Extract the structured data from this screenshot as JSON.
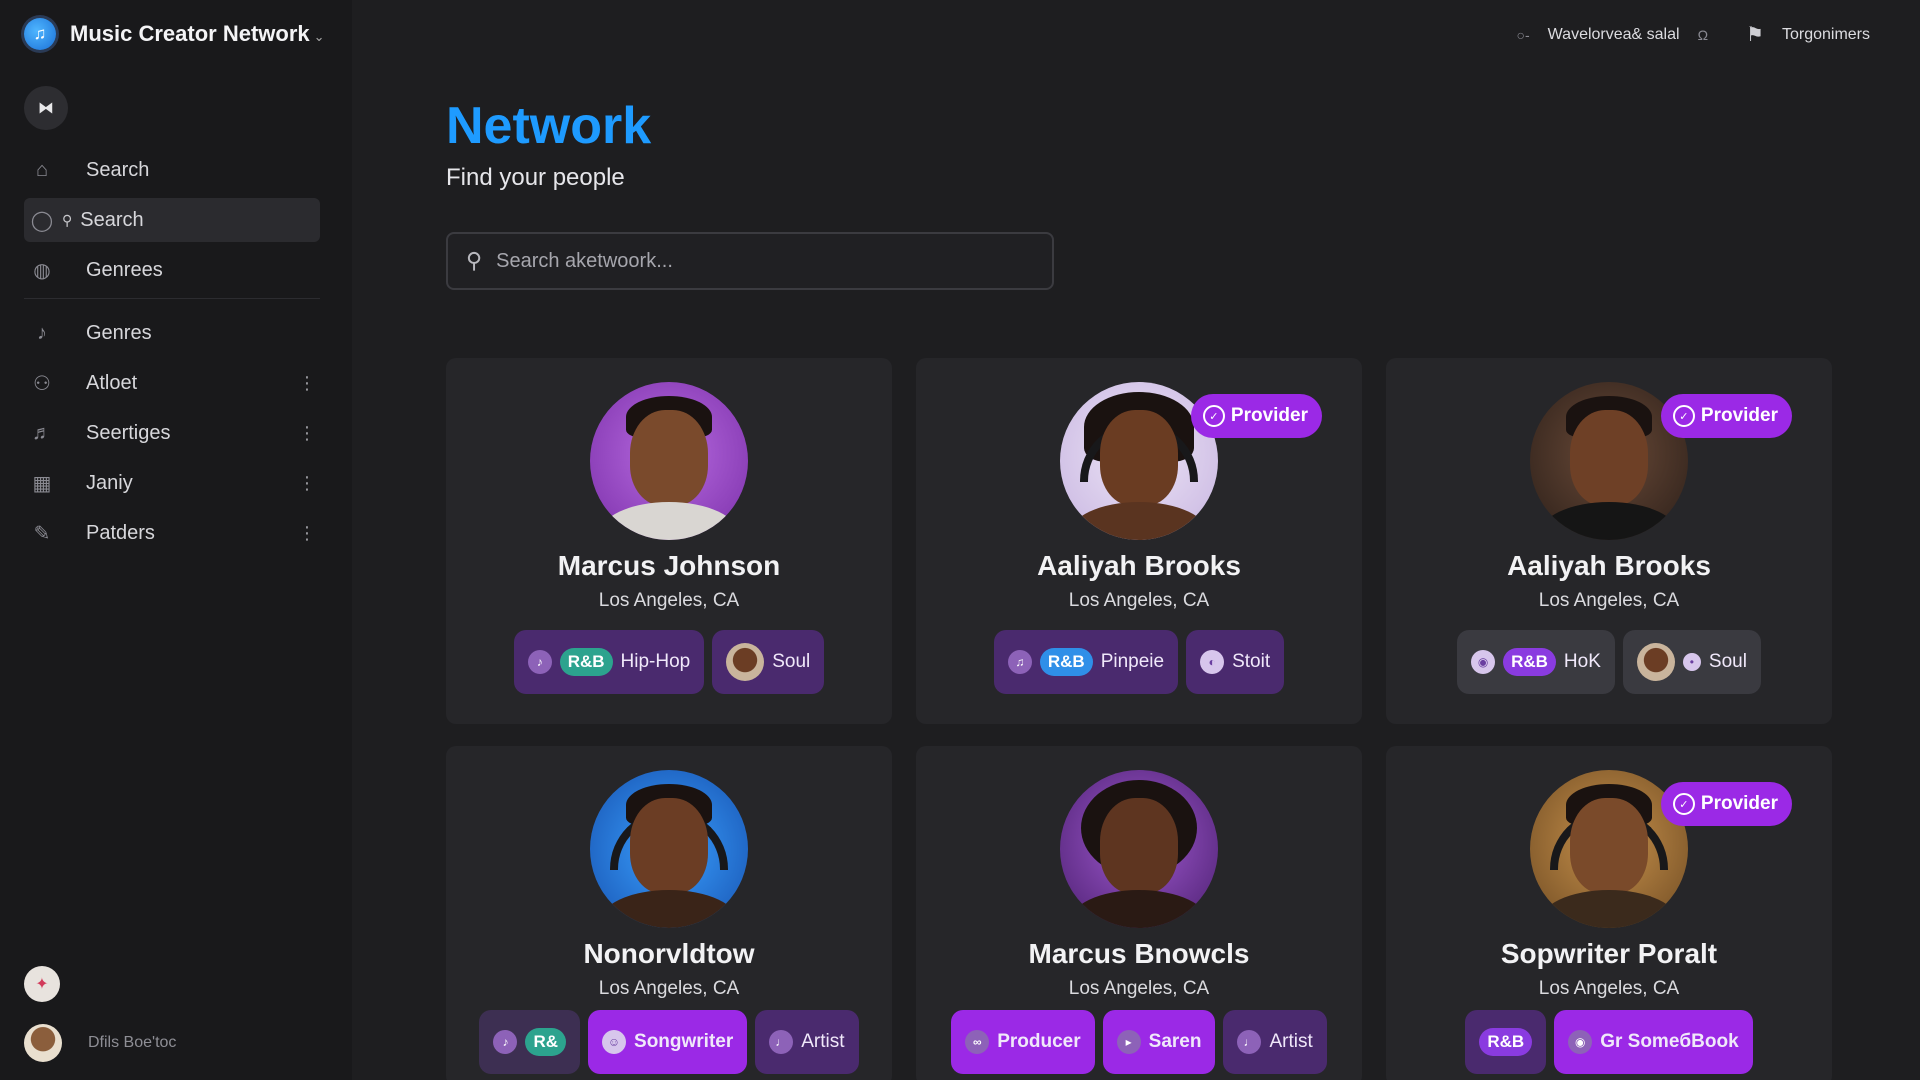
{
  "app": {
    "title": "Music Creator Network",
    "caret": "⌄"
  },
  "sidebar": {
    "items": [
      {
        "label": "Search",
        "icon": "home-icon"
      },
      {
        "label": "Search",
        "icon": "search-icon",
        "active": true
      },
      {
        "label": "Genrees",
        "icon": "globe-icon"
      },
      {
        "label": "Genres",
        "icon": "music-note-icon"
      },
      {
        "label": "Atloet",
        "icon": "network-icon",
        "menu": true
      },
      {
        "label": "Seertiges",
        "icon": "music-add-icon",
        "menu": true
      },
      {
        "label": "Janiy",
        "icon": "grid-icon",
        "menu": true
      },
      {
        "label": "Patders",
        "icon": "pin-icon",
        "menu": true
      }
    ],
    "user": {
      "name": "Dfils Boe'toc"
    }
  },
  "topbar": {
    "item1": "Wavelorvea& salal",
    "item2": "Torgonimers"
  },
  "page": {
    "title": "Network",
    "subtitle": "Find your people",
    "search_placeholder": "Search aketwoork..."
  },
  "provider_label": "Provider",
  "cards": [
    {
      "name": "Marcus Johnson",
      "location": "Los Angeles, CA",
      "provider": false,
      "tags": [
        {
          "pill": "R&B",
          "label": "Hip-Hop"
        },
        {
          "label": "Soul"
        }
      ]
    },
    {
      "name": "Aaliyah Brooks",
      "location": "Los Angeles, CA",
      "provider": true,
      "tags": [
        {
          "pill": "R&B",
          "label": "Pinpeie"
        },
        {
          "label": "Stoit"
        }
      ]
    },
    {
      "name": "Aaliyah Brooks",
      "location": "Los Angeles, CA",
      "provider": true,
      "tags": [
        {
          "pill": "R&B",
          "label": "HoK"
        },
        {
          "label": "Soul"
        }
      ]
    },
    {
      "name": "Nonorvldtow",
      "location": "Los Angeles, CA",
      "provider": false,
      "tags": [
        {
          "pill": "R&"
        },
        {
          "label": "Songwriter"
        },
        {
          "label": "Artist"
        }
      ]
    },
    {
      "name": "Marcus Bnowcls",
      "location": "Los Angeles, CA",
      "provider": false,
      "tags": [
        {
          "label": "Producer"
        },
        {
          "label": "Saren"
        },
        {
          "label": "Artist"
        }
      ]
    },
    {
      "name": "Sopwriter Poralt",
      "location": "Los Angeles, CA",
      "provider": true,
      "tags": [
        {
          "label": "R&B"
        },
        {
          "label": "Gr SomeбBook"
        }
      ]
    }
  ],
  "colors": {
    "accent": "#1e9bff",
    "provider": "#9b29e6",
    "tag": "#4a2a6e",
    "background": "#1e1e20",
    "sidebar": "#19191b"
  }
}
